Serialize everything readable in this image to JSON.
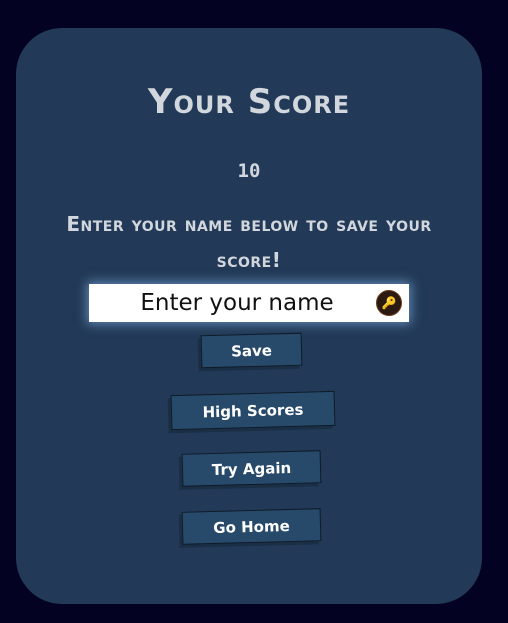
{
  "card": {
    "title": "Your Score",
    "score": "10",
    "prompt": "Enter your name below to save your score!"
  },
  "form": {
    "name_placeholder": "Enter your name",
    "key_icon": "password-manager-key-icon"
  },
  "buttons": {
    "save": "Save",
    "high_scores": "High Scores",
    "try_again": "Try Again",
    "go_home": "Go Home"
  },
  "colors": {
    "page_background": "#040222",
    "card_background": "#223a57",
    "button_background": "#27496a",
    "text": "#d2d6dd"
  }
}
